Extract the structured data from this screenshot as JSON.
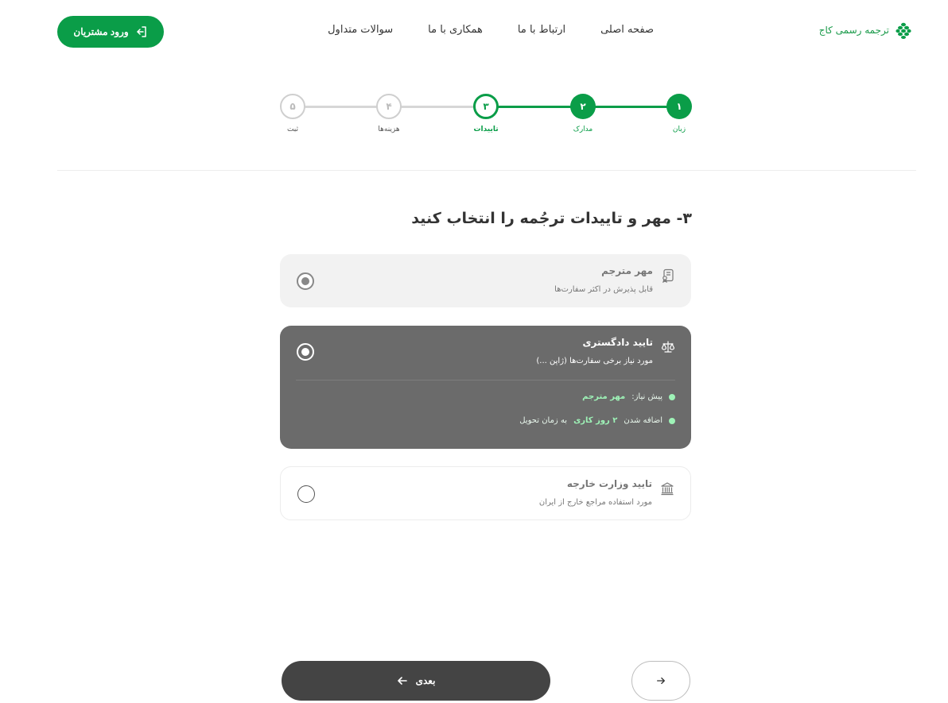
{
  "header": {
    "brand": "ترجمه رسمی کاج",
    "nav": [
      "صفحه اصلی",
      "ارتباط با ما",
      "همکاری با ما",
      "سوالات متداول"
    ],
    "login_label": "ورود مشتریان"
  },
  "stepper": {
    "steps": [
      {
        "num": "۱",
        "label": "زبان",
        "state": "done"
      },
      {
        "num": "۲",
        "label": "مدارک",
        "state": "done"
      },
      {
        "num": "۳",
        "label": "تاییدات",
        "state": "active"
      },
      {
        "num": "۴",
        "label": "هزینه‌ها",
        "state": "pending"
      },
      {
        "num": "۵",
        "label": "ثبت",
        "state": "pending"
      }
    ]
  },
  "section": {
    "title": "۳- مهر و تاییدات ترجُمه را انتخاب کنید"
  },
  "options": [
    {
      "title": "مهر مترجم",
      "subtitle": "قابل پذیرش در اکثر سفارت‌ها",
      "icon": "certificate-icon",
      "selected": true
    },
    {
      "title": "تایید دادگستری",
      "subtitle": "مورد نیاز برخی سفارت‌ها (ژاپن ...)",
      "icon": "scales-icon",
      "selected": true,
      "bullets": [
        {
          "prefix": "پیش نیاز:",
          "highlight": "مهر مترجم",
          "suffix": ""
        },
        {
          "prefix": "اضافه شدن",
          "highlight": "۲ روز کاری",
          "suffix": "به زمان تحویل"
        }
      ]
    },
    {
      "title": "تایید وزارت خارجه",
      "subtitle": "مورد استفاده مراجع خارج از ایران",
      "icon": "government-building-icon",
      "selected": false
    }
  ],
  "footer": {
    "next_label": "بعدی"
  },
  "colors": {
    "brand_green": "#0a9d48",
    "selected_card": "#6b6b6b",
    "next_button": "#444444",
    "bullet_highlight": "#9ef3b7"
  }
}
